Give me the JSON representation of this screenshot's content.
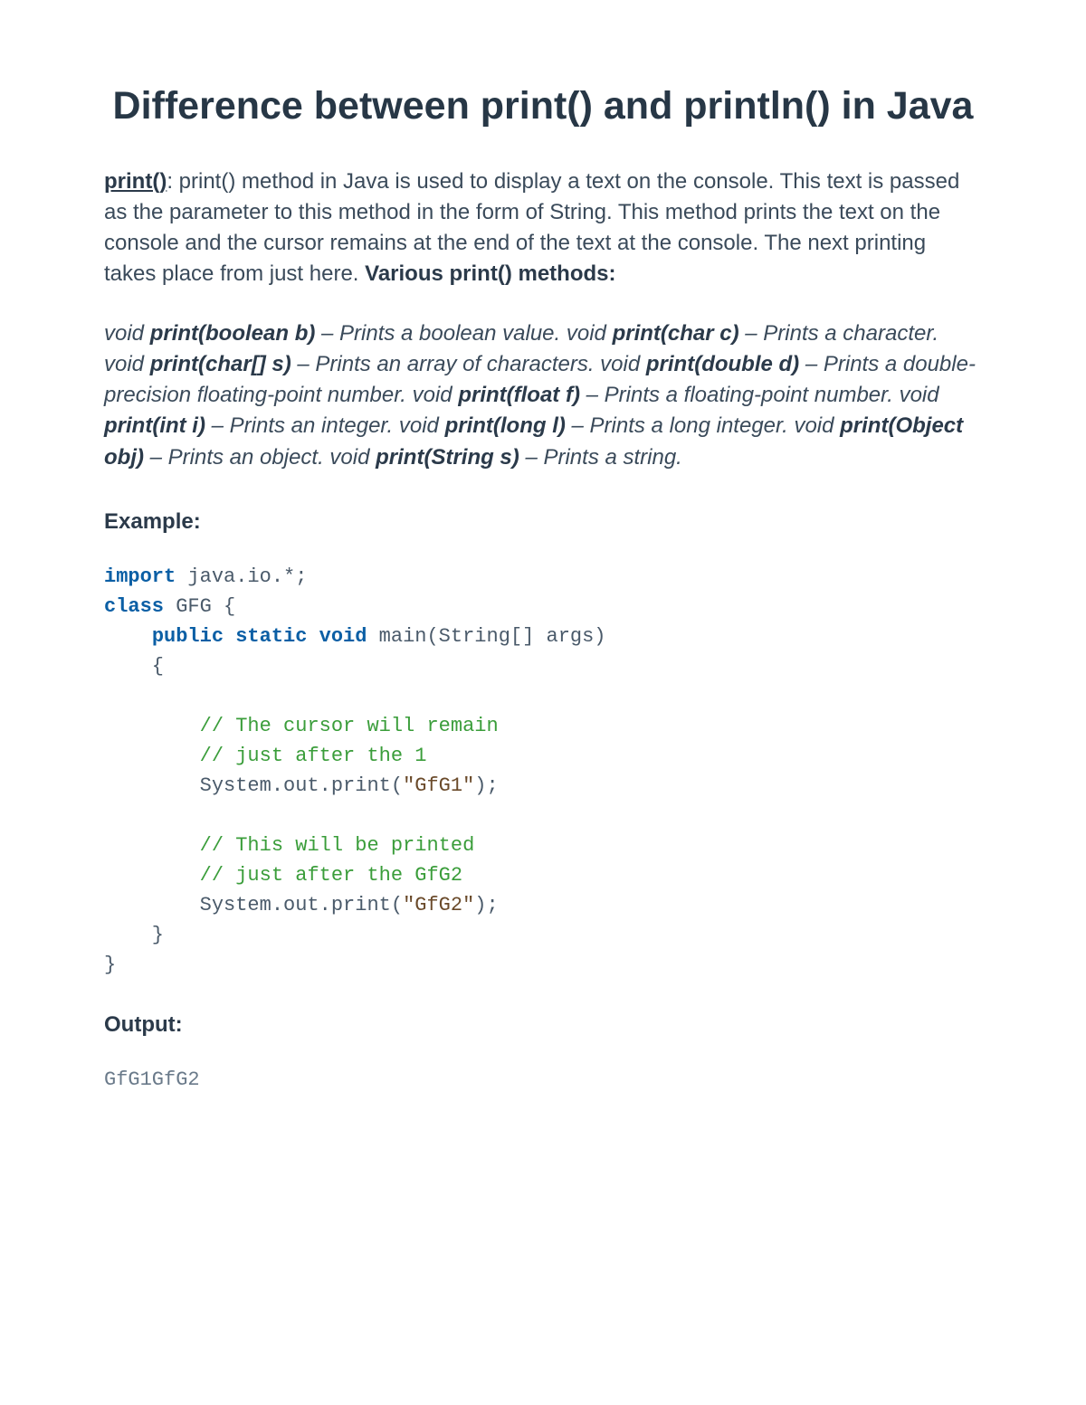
{
  "title": "Difference between print() and println() in Java",
  "intro": {
    "link_text": "print()",
    "body": ": print() method in Java is used to display a text on the console. This text is passed as the parameter to this method in the form of String. This method prints the text on the console and the cursor remains at the end of the text at the console. The next printing takes place from just here. ",
    "bold_tail": "Various print() methods:"
  },
  "methods": {
    "m1_pre": "void ",
    "m1_sig": "print(boolean b)",
    "m1_desc": " – Prints a boolean value. void ",
    "m2_sig": "print(char c)",
    "m2_desc": " – Prints a character. void ",
    "m3_sig": "print(char[] s)",
    "m3_desc": " – Prints an array of characters. void ",
    "m4_sig": "print(double d)",
    "m4_desc": " – Prints a double-precision floating-point number. void ",
    "m5_sig": "print(float f)",
    "m5_desc": " – Prints a floating-point number. void ",
    "m6_sig": "print(int i)",
    "m6_desc": " – Prints an integer. void ",
    "m7_sig": "print(long l)",
    "m7_desc": " – Prints a long integer. void ",
    "m8_sig": "print(Object obj)",
    "m8_desc": " – Prints an object. void ",
    "m9_sig": "print(String s)",
    "m9_desc": " – Prints a string."
  },
  "example_label": "Example:",
  "code": {
    "l1_kw": "import",
    "l1_rest": " java.io.*;",
    "l2_kw": "class",
    "l2_rest": " GFG {",
    "l3_indent": "    ",
    "l3_kw1": "public",
    "l3_sp1": " ",
    "l3_kw2": "static",
    "l3_sp2": " ",
    "l3_kw3": "void",
    "l3_rest": " main(String[] args)",
    "l4": "    {",
    "l5": "",
    "l6_indent": "        ",
    "l6_cm": "// The cursor will remain",
    "l7_indent": "        ",
    "l7_cm": "// just after the 1",
    "l8_indent": "        System.out.print(",
    "l8_str": "\"GfG1\"",
    "l8_rest": ");",
    "l9": "",
    "l10_indent": "        ",
    "l10_cm": "// This will be printed",
    "l11_indent": "        ",
    "l11_cm": "// just after the GfG2",
    "l12_indent": "        System.out.print(",
    "l12_str": "\"GfG2\"",
    "l12_rest": ");",
    "l13": "    }",
    "l14": "}"
  },
  "output_label": "Output:",
  "output_text": "GfG1GfG2"
}
